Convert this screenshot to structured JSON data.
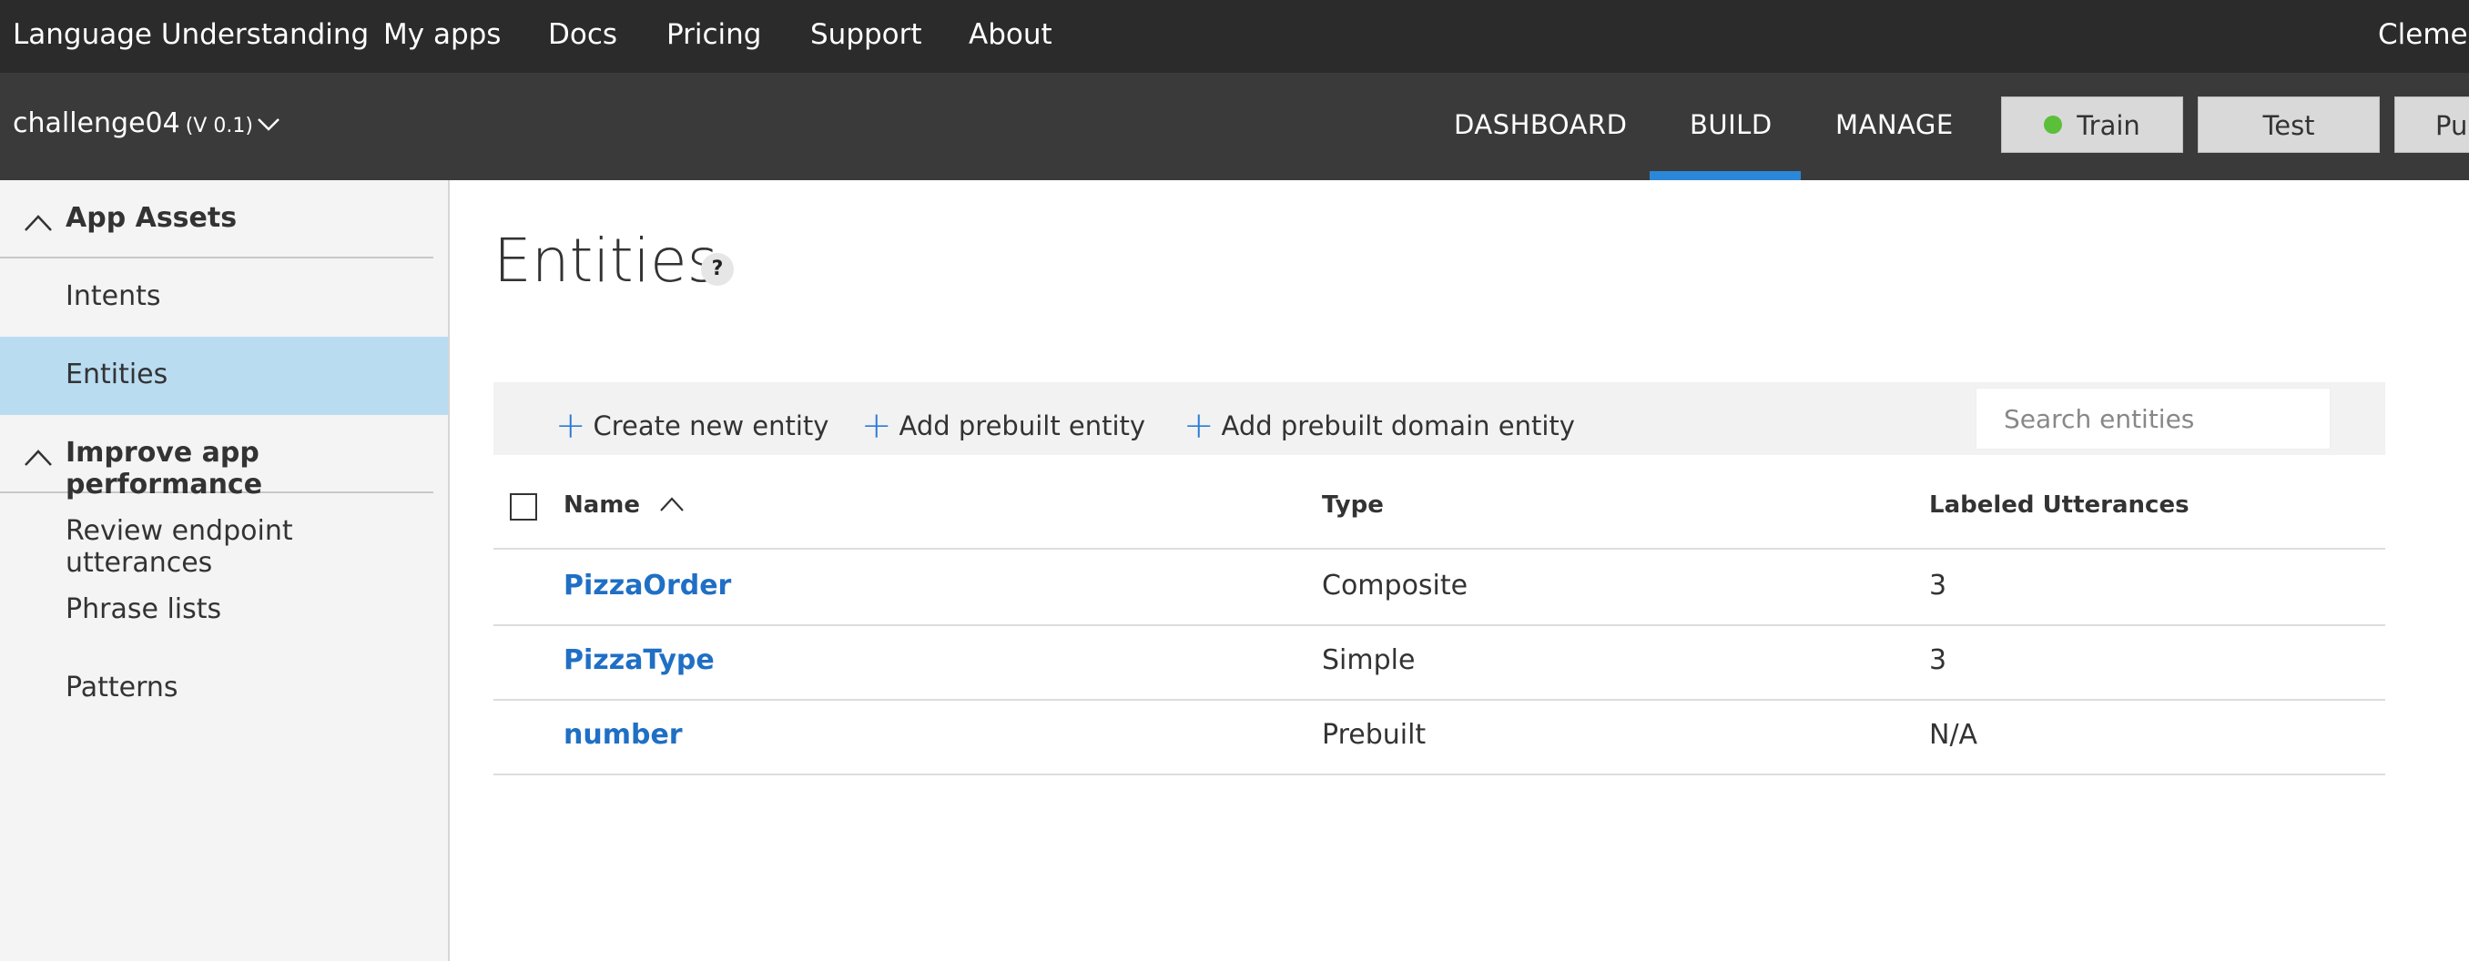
{
  "topnav": {
    "brand": "Language Understanding",
    "links": [
      "My apps",
      "Docs",
      "Pricing",
      "Support",
      "About"
    ],
    "user": "Clement"
  },
  "appbar": {
    "app_name": "challenge04",
    "version": "(V 0.1)",
    "tabs": [
      "DASHBOARD",
      "BUILD",
      "MANAGE"
    ],
    "active_tab": "BUILD",
    "buttons": {
      "train": "Train",
      "test": "Test",
      "publish": "Pu"
    },
    "train_status_color": "#5bbf3a",
    "accent_color": "#2b88d8"
  },
  "sidebar": {
    "sections": [
      {
        "title": "App Assets",
        "items": [
          "Intents",
          "Entities"
        ]
      },
      {
        "title": "Improve app performance",
        "items": [
          "Review endpoint utterances",
          "Phrase lists",
          "Patterns"
        ]
      }
    ],
    "selected_item": "Entities"
  },
  "main": {
    "title": "Entities",
    "help": "?",
    "toolbar": {
      "create": "Create new entity",
      "add_prebuilt": "Add prebuilt entity",
      "add_domain": "Add prebuilt domain entity",
      "search_placeholder": "Search entities"
    },
    "table": {
      "columns": [
        "Name",
        "Type",
        "Labeled Utterances"
      ],
      "sort_column": "Name",
      "rows": [
        {
          "name": "PizzaOrder",
          "type": "Composite",
          "utterances": "3"
        },
        {
          "name": "PizzaType",
          "type": "Simple",
          "utterances": "3"
        },
        {
          "name": "number",
          "type": "Prebuilt",
          "utterances": "N/A"
        }
      ]
    }
  }
}
